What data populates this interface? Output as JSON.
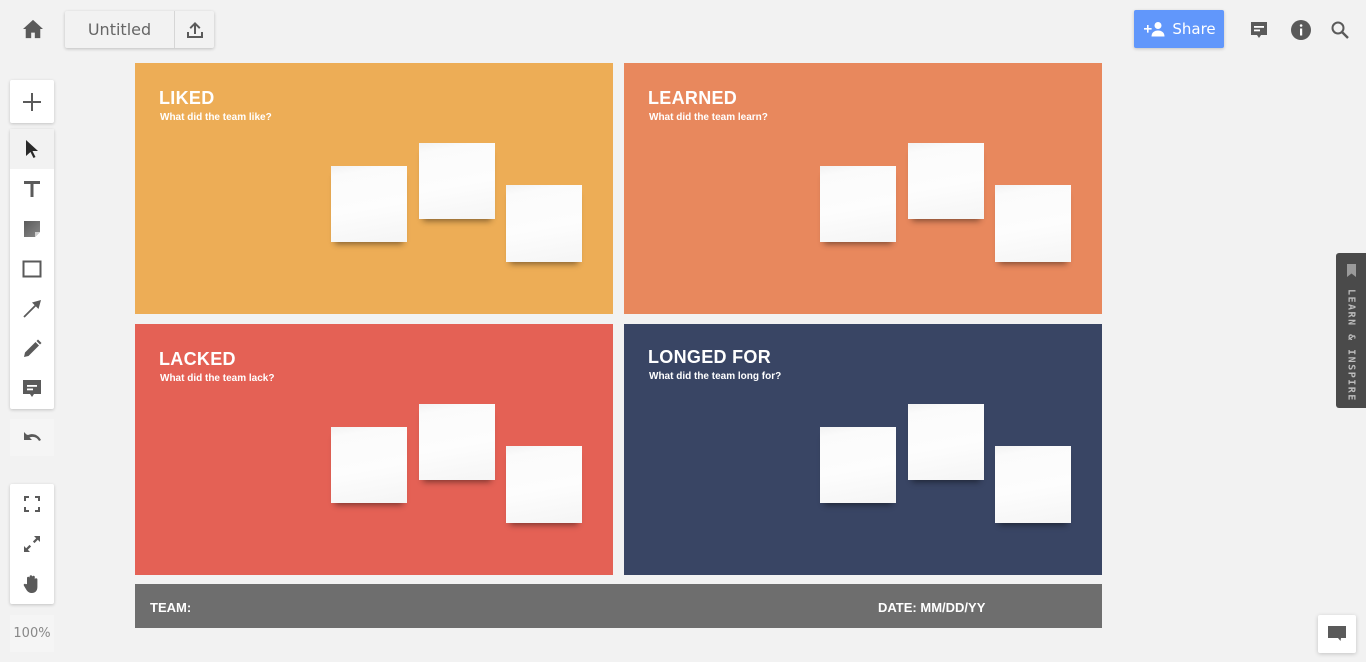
{
  "header": {
    "doc_title": "Untitled",
    "share_label": "Share",
    "icons": {
      "home": "home-icon",
      "export": "upload-icon",
      "share": "person-add-icon",
      "comments": "comment-icon",
      "info": "info-icon",
      "search": "search-icon"
    }
  },
  "toolbar": {
    "tools": [
      {
        "id": "add",
        "icon": "plus-icon"
      },
      {
        "id": "select",
        "icon": "cursor-arrow-icon",
        "active": true
      },
      {
        "id": "text",
        "icon": "text-icon"
      },
      {
        "id": "sticky-note",
        "icon": "sticky-note-icon"
      },
      {
        "id": "rectangle",
        "icon": "rectangle-icon"
      },
      {
        "id": "arrow",
        "icon": "arrow-icon"
      },
      {
        "id": "pen",
        "icon": "pencil-icon"
      },
      {
        "id": "comment",
        "icon": "comment-icon"
      },
      {
        "id": "undo",
        "icon": "undo-icon"
      },
      {
        "id": "fit",
        "icon": "fit-screen-icon"
      },
      {
        "id": "fullscreen",
        "icon": "expand-icon"
      },
      {
        "id": "pan",
        "icon": "hand-icon"
      }
    ],
    "zoom_level": "100%"
  },
  "board": {
    "quadrants": [
      {
        "title": "LIKED",
        "subtitle": "What did the team like?",
        "color": "#edad56"
      },
      {
        "title": "LEARNED",
        "subtitle": "What did the team learn?",
        "color": "#e8885d"
      },
      {
        "title": "LACKED",
        "subtitle": "What did the team lack?",
        "color": "#e46155"
      },
      {
        "title": "LONGED FOR",
        "subtitle": "What did the team long for?",
        "color": "#394564"
      }
    ],
    "footer": {
      "team_label": "TEAM:",
      "date_label": "DATE: MM/DD/YY",
      "color": "#6e6e6e"
    }
  },
  "side": {
    "learn_tab_label": "LEARN & INSPIRE",
    "chat_icon": "chat-icon"
  },
  "colors": {
    "accent": "#6197fb",
    "background": "#f2f2f2",
    "icon": "#5a5a5a"
  }
}
